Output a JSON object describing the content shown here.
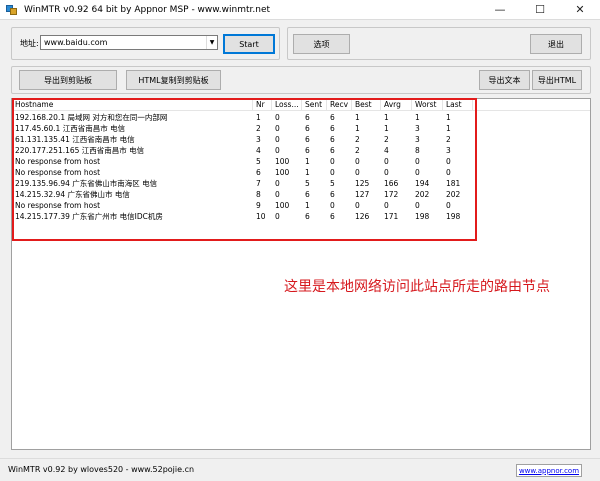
{
  "window": {
    "title": "WinMTR v0.92 64 bit by Appnor MSP - www.winmtr.net",
    "minimize_glyph": "—",
    "maximize_glyph": "☐",
    "close_glyph": "✕"
  },
  "toolbar": {
    "host_label": "地址:",
    "host_value": "www.baidu.com",
    "start_label": "Start",
    "options_label": "选项",
    "exit_label": "退出",
    "copy_text_label": "导出到剪贴板",
    "copy_html_label": "HTML复制到剪贴板",
    "export_text_label": "导出文本",
    "export_html_label": "导出HTML"
  },
  "table": {
    "columns": [
      "Hostname",
      "Nr",
      "Loss...",
      "Sent",
      "Recv",
      "Best",
      "Avrg",
      "Worst",
      "Last"
    ],
    "rows": [
      [
        "192.168.20.1 局域网 对方和您在同一内部网",
        "1",
        "0",
        "6",
        "6",
        "1",
        "1",
        "1",
        "1"
      ],
      [
        "117.45.60.1 江西省南昌市 电信",
        "2",
        "0",
        "6",
        "6",
        "1",
        "1",
        "3",
        "1"
      ],
      [
        "61.131.135.41 江西省南昌市 电信",
        "3",
        "0",
        "6",
        "6",
        "2",
        "2",
        "3",
        "2"
      ],
      [
        "220.177.251.165 江西省南昌市 电信",
        "4",
        "0",
        "6",
        "6",
        "2",
        "4",
        "8",
        "3"
      ],
      [
        "No response from host",
        "5",
        "100",
        "1",
        "0",
        "0",
        "0",
        "0",
        "0"
      ],
      [
        "No response from host",
        "6",
        "100",
        "1",
        "0",
        "0",
        "0",
        "0",
        "0"
      ],
      [
        "219.135.96.94 广东省佛山市南海区 电信",
        "7",
        "0",
        "5",
        "5",
        "125",
        "166",
        "194",
        "181"
      ],
      [
        "14.215.32.94 广东省佛山市 电信",
        "8",
        "0",
        "6",
        "6",
        "127",
        "172",
        "202",
        "202"
      ],
      [
        "No response from host",
        "9",
        "100",
        "1",
        "0",
        "0",
        "0",
        "0",
        "0"
      ],
      [
        "14.215.177.39 广东省广州市 电信IDC机房",
        "10",
        "0",
        "6",
        "6",
        "126",
        "171",
        "198",
        "198"
      ]
    ]
  },
  "annotation": "这里是本地网络访问此站点所走的路由节点",
  "status": {
    "text": "WinMTR v0.92 by wloves520 - www.52pojie.cn",
    "link": "www.appnor.com"
  },
  "colors": {
    "highlight": "#e21b1b",
    "annotation": "#d6181d"
  }
}
